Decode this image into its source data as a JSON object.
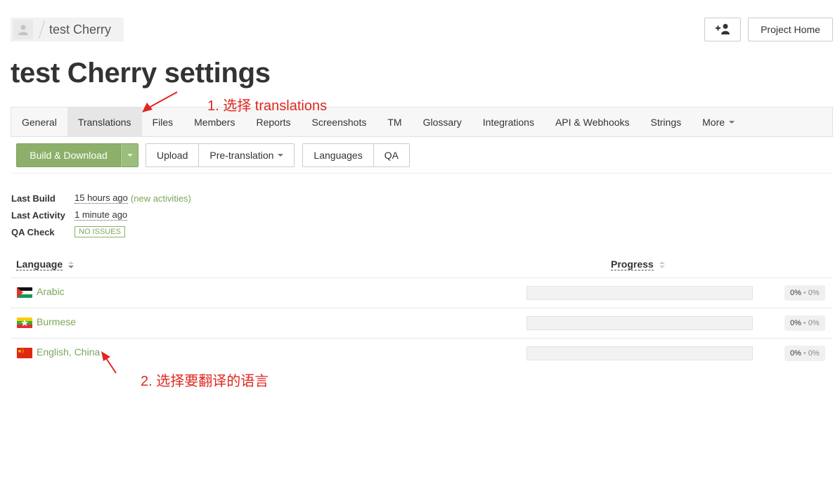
{
  "header": {
    "breadcrumb_title": "test Cherry",
    "add_user_icon": "add-user-icon",
    "project_home_label": "Project Home"
  },
  "page_title": "test Cherry settings",
  "tabs": [
    {
      "label": "General",
      "active": false
    },
    {
      "label": "Translations",
      "active": true
    },
    {
      "label": "Files",
      "active": false
    },
    {
      "label": "Members",
      "active": false
    },
    {
      "label": "Reports",
      "active": false
    },
    {
      "label": "Screenshots",
      "active": false
    },
    {
      "label": "TM",
      "active": false
    },
    {
      "label": "Glossary",
      "active": false
    },
    {
      "label": "Integrations",
      "active": false
    },
    {
      "label": "API & Webhooks",
      "active": false
    },
    {
      "label": "Strings",
      "active": false
    },
    {
      "label": "More",
      "active": false
    }
  ],
  "toolbar": {
    "build_download": "Build & Download",
    "upload": "Upload",
    "pre_translation": "Pre-translation",
    "languages": "Languages",
    "qa": "QA"
  },
  "stats": {
    "last_build_label": "Last Build",
    "last_build_value": "15 hours ago",
    "last_build_extra": "(new activities)",
    "last_activity_label": "Last Activity",
    "last_activity_value": "1 minute ago",
    "qa_check_label": "QA Check",
    "qa_check_value": "NO ISSUES"
  },
  "table": {
    "col_language": "Language",
    "col_progress": "Progress",
    "rows": [
      {
        "name": "Arabic",
        "flag": "palestine-flag",
        "translated": "0%",
        "approved": "0%",
        "progress": 0
      },
      {
        "name": "Burmese",
        "flag": "myanmar-flag",
        "translated": "0%",
        "approved": "0%",
        "progress": 0
      },
      {
        "name": "English, China",
        "flag": "china-flag",
        "translated": "0%",
        "approved": "0%",
        "progress": 0
      }
    ]
  },
  "annotations": {
    "step1": "1. 选择 translations",
    "step2": "2. 选择要翻译的语言"
  },
  "colors": {
    "accent_green": "#8cb06a",
    "link_green": "#7ba65a",
    "annotation_red": "#e0271f"
  }
}
